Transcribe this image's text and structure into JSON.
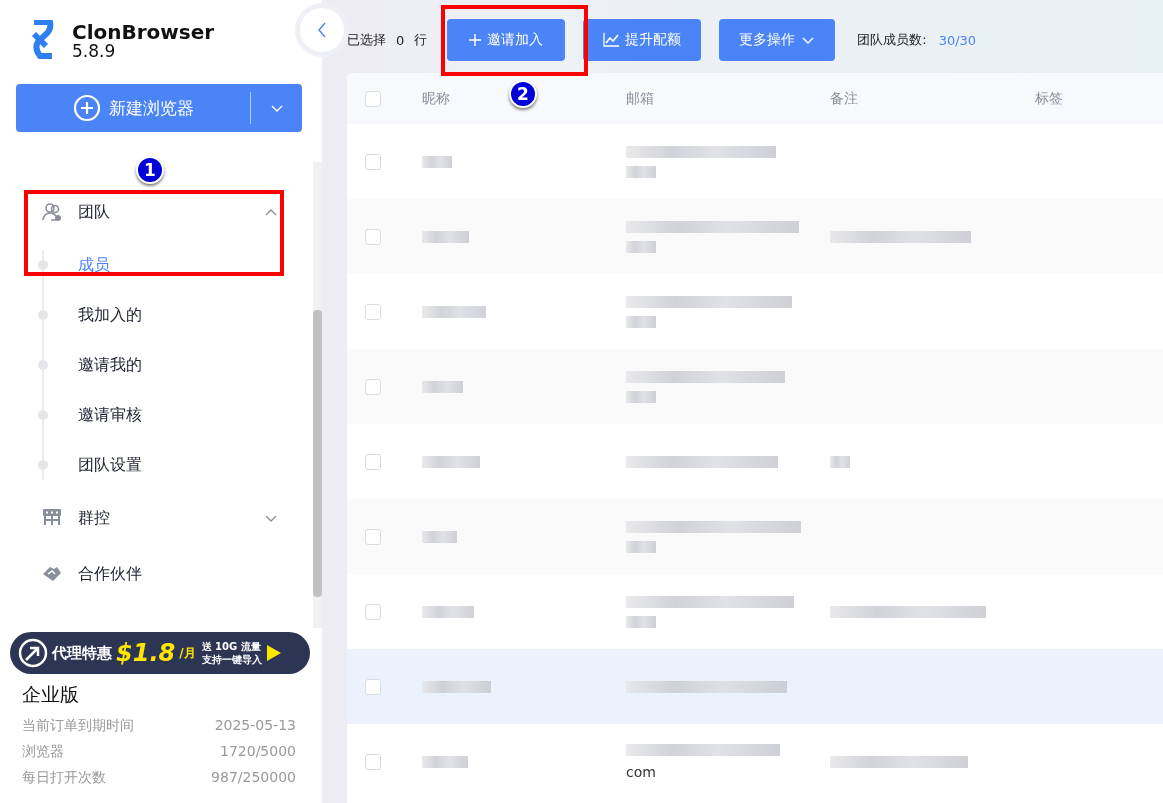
{
  "app": {
    "name": "ClonBrowser",
    "version": "5.8.9"
  },
  "new_browser_button": {
    "label": "新建浏览器"
  },
  "menu": [
    {
      "kind": "group",
      "label": "团队",
      "expanded": true,
      "children": [
        {
          "label": "成员",
          "selected": true
        },
        {
          "label": "我加入的",
          "selected": false
        },
        {
          "label": "邀请我的",
          "selected": false
        },
        {
          "label": "邀请审核",
          "selected": false
        },
        {
          "label": "团队设置",
          "selected": false
        }
      ]
    },
    {
      "kind": "group",
      "label": "群控",
      "expanded": false
    },
    {
      "kind": "link",
      "label": "合作伙伴"
    }
  ],
  "promo_banner": {
    "label": "代理特惠",
    "price": "$1.8",
    "unit": "/月",
    "line_1": "送 10G 流量",
    "line_2": "支持一键导入"
  },
  "plan": {
    "title": "企业版",
    "rows": [
      {
        "label": "当前订单到期时间",
        "value": "2025-05-13"
      },
      {
        "label": "浏览器",
        "value": "1720/5000"
      },
      {
        "label": "每日打开次数",
        "value": "987/250000"
      }
    ]
  },
  "toolbar": {
    "selected_label": "已选择",
    "selected_count": "0",
    "selected_unit": "行",
    "buttons": [
      {
        "kind": "invite",
        "label": "邀请加入"
      },
      {
        "kind": "upgrade",
        "label": "提升配额"
      },
      {
        "kind": "more",
        "label": "更多操作"
      }
    ],
    "member_count_label": "团队成员数:",
    "member_count": "30/30"
  },
  "table": {
    "columns": [
      "昵称",
      "邮箱",
      "备注",
      "标签"
    ],
    "header_checked": false,
    "rows": [
      {
        "checked": false,
        "highlighted": false,
        "email_wrapped": true,
        "has_note": false
      },
      {
        "checked": false,
        "highlighted": false,
        "email_wrapped": true,
        "has_note": true
      },
      {
        "checked": false,
        "highlighted": false,
        "email_wrapped": true,
        "has_note": false
      },
      {
        "checked": false,
        "highlighted": false,
        "email_wrapped": true,
        "has_note": false
      },
      {
        "checked": false,
        "highlighted": false,
        "email_wrapped": false,
        "has_note": true
      },
      {
        "checked": false,
        "highlighted": false,
        "email_wrapped": true,
        "has_note": false
      },
      {
        "checked": false,
        "highlighted": false,
        "email_wrapped": true,
        "has_note": true
      },
      {
        "checked": false,
        "highlighted": true,
        "email_wrapped": false,
        "has_note": false
      },
      {
        "checked": false,
        "highlighted": false,
        "email_wrapped": true,
        "has_note": true,
        "email_tail": "com"
      }
    ]
  },
  "annotations": [
    {
      "label": "1"
    },
    {
      "label": "2"
    }
  ]
}
